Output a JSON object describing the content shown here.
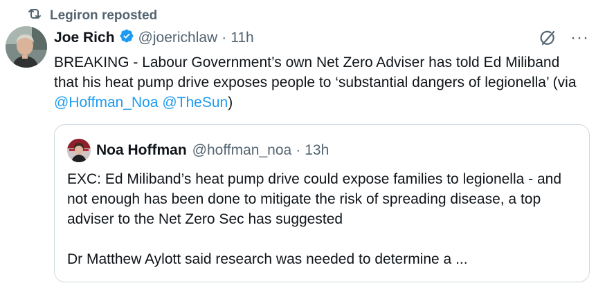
{
  "repost": {
    "label": "Legiron reposted",
    "icon": "repost-icon"
  },
  "tweet": {
    "author_name": "Joe Rich",
    "verified": true,
    "handle": "@joerichlaw",
    "separator": "·",
    "time": "11h",
    "text_before": "BREAKING - Labour Government’s own Net Zero Adviser has told Ed Miliband that his heat pump drive exposes people to ‘substantial dangers of legionella’ (via ",
    "mention_1": "@Hoffman_Noa",
    "mention_2": "@TheSun",
    "text_after": ")",
    "actions": {
      "grok_icon": "grok-icon",
      "more_label": "···"
    }
  },
  "quote": {
    "author_name": "Noa Hoffman",
    "handle": "@hoffman_noa",
    "separator": "·",
    "time": "13h",
    "paragraph_1": "EXC: Ed Miliband’s heat pump drive could expose families to legionella - and not enough has been done to mitigate the risk of spreading disease, a top adviser to the Net Zero Sec has suggested",
    "paragraph_2": "Dr Matthew Aylott said research was needed to determine a ..."
  },
  "colors": {
    "link": "#1d9bf0",
    "secondary_text": "#536471",
    "verified_badge": "#1d9bf0",
    "border": "#cfd9de"
  }
}
